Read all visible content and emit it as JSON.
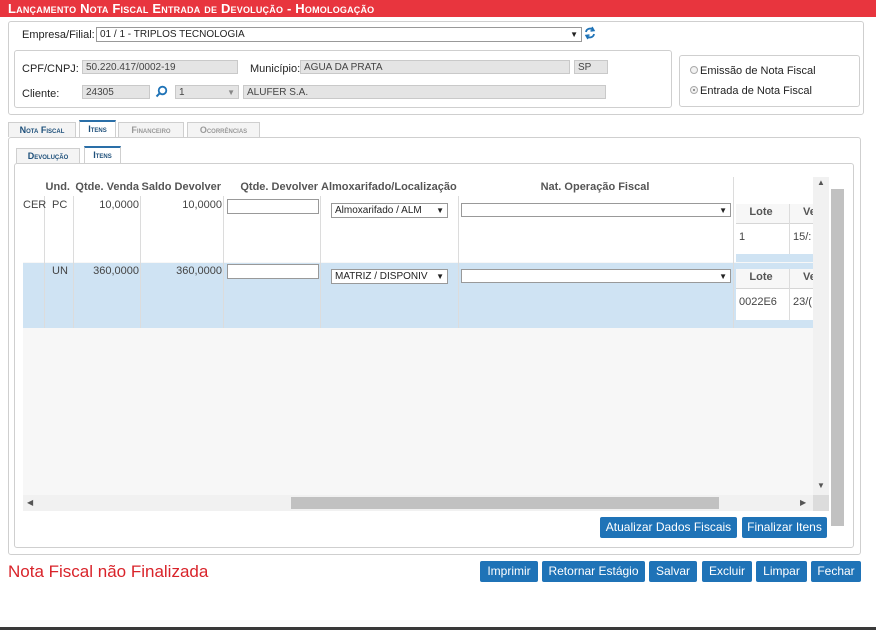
{
  "window": {
    "title": "Lançamento Nota Fiscal Entrada de Devolução  - Homologação"
  },
  "header": {
    "empresa_label": "Empresa/Filial:",
    "empresa_value": "01 / 1 - TRIPLOS TECNOLOGIA",
    "cpf_label": "CPF/CNPJ:",
    "cpf_value": "50.220.417/0002-19",
    "municipio_label": "Município:",
    "municipio_value": "AGUA DA PRATA",
    "uf_value": "SP",
    "cliente_label": "Cliente:",
    "cliente_code": "24305",
    "cliente_seq": "1",
    "cliente_name": "ALUFER S.A.",
    "radio_emissao": "Emissão de Nota Fiscal",
    "radio_entrada": "Entrada de Nota Fiscal"
  },
  "tabs": [
    {
      "label": "Nota Fiscal"
    },
    {
      "label": "Itens"
    },
    {
      "label": "Financeiro"
    },
    {
      "label": "Ocorrências"
    }
  ],
  "subtabs": [
    {
      "label": "Devolução"
    },
    {
      "label": "Itens"
    }
  ],
  "table": {
    "columns": [
      "Und.",
      "Qtde. Venda",
      "Saldo Devolver",
      "Qtde. Devolver",
      "Almoxarifado/Localização",
      "Nat. Operação Fiscal"
    ],
    "rows": [
      {
        "prefix": "CER",
        "und": "PC",
        "qtde_venda": "10,0000",
        "saldo": "10,0000",
        "almox": "Almoxarifado / ALM",
        "lote_header": "Lote",
        "ve_header": "Ve",
        "lote": "1",
        "ve": "15/:"
      },
      {
        "prefix": "",
        "und": "UN",
        "qtde_venda": "360,0000",
        "saldo": "360,0000",
        "almox": "MATRIZ / DISPONIV",
        "lote_header": "Lote",
        "ve_header": "Ve",
        "lote": "0022E6",
        "ve": "23/("
      }
    ]
  },
  "buttons": {
    "atualizar": "Atualizar Dados Fiscais",
    "finalizar": "Finalizar Itens",
    "imprimir": "Imprimir",
    "retornar": "Retornar Estágio",
    "salvar": "Salvar",
    "excluir": "Excluir",
    "limpar": "Limpar",
    "fechar": "Fechar"
  },
  "status": {
    "text": "Nota Fiscal não Finalizada",
    "color": "#d9232a"
  },
  "colors": {
    "title_bar": "#e8353e",
    "button": "#1f73b7",
    "row_highlight": "#cfe3f3"
  },
  "icons": {
    "refresh": "refresh-icon",
    "search": "search-icon"
  }
}
